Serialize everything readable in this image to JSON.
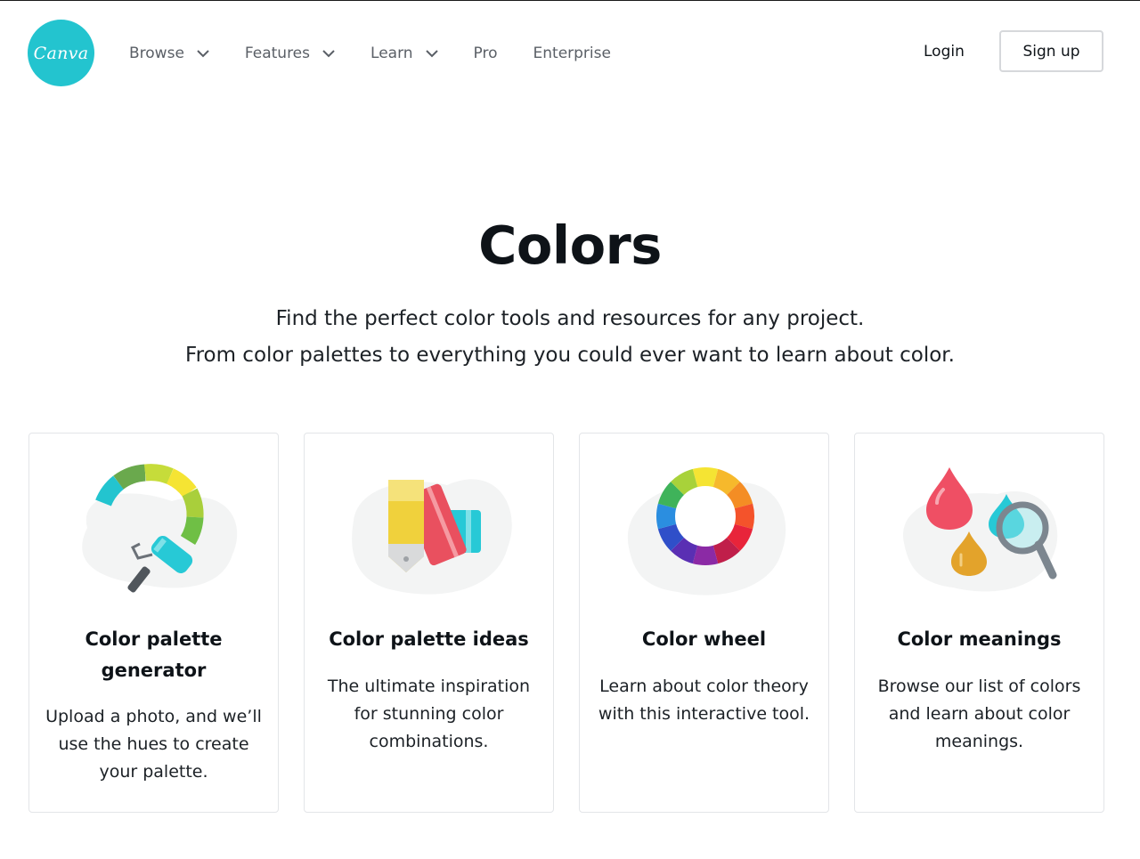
{
  "header": {
    "logo_text": "Canva",
    "nav": [
      {
        "label": "Browse",
        "has_dropdown": true
      },
      {
        "label": "Features",
        "has_dropdown": true
      },
      {
        "label": "Learn",
        "has_dropdown": true
      },
      {
        "label": "Pro",
        "has_dropdown": false
      },
      {
        "label": "Enterprise",
        "has_dropdown": false
      }
    ],
    "login_label": "Login",
    "signup_label": "Sign up"
  },
  "hero": {
    "title": "Colors",
    "subtitle_line1": "Find the perfect color tools and resources for any project.",
    "subtitle_line2": "From color palettes to everything you could ever want to learn about color."
  },
  "cards": [
    {
      "title": "Color palette generator",
      "description": "Upload a photo, and we’ll use the hues to create your palette.",
      "icon": "paint-roller-icon"
    },
    {
      "title": "Color palette ideas",
      "description": "The ultimate inspiration for stunning color combinations.",
      "icon": "color-swatches-icon"
    },
    {
      "title": "Color wheel",
      "description": "Learn about color theory with this interactive tool.",
      "icon": "color-wheel-icon"
    },
    {
      "title": "Color meanings",
      "description": "Browse our list of colors and learn about color meanings.",
      "icon": "color-drops-magnifier-icon"
    }
  ],
  "colors": {
    "brand": "#23c4cf",
    "text": "#0e1318",
    "nav_text": "#5a5f66",
    "border": "#e3e5e8"
  }
}
